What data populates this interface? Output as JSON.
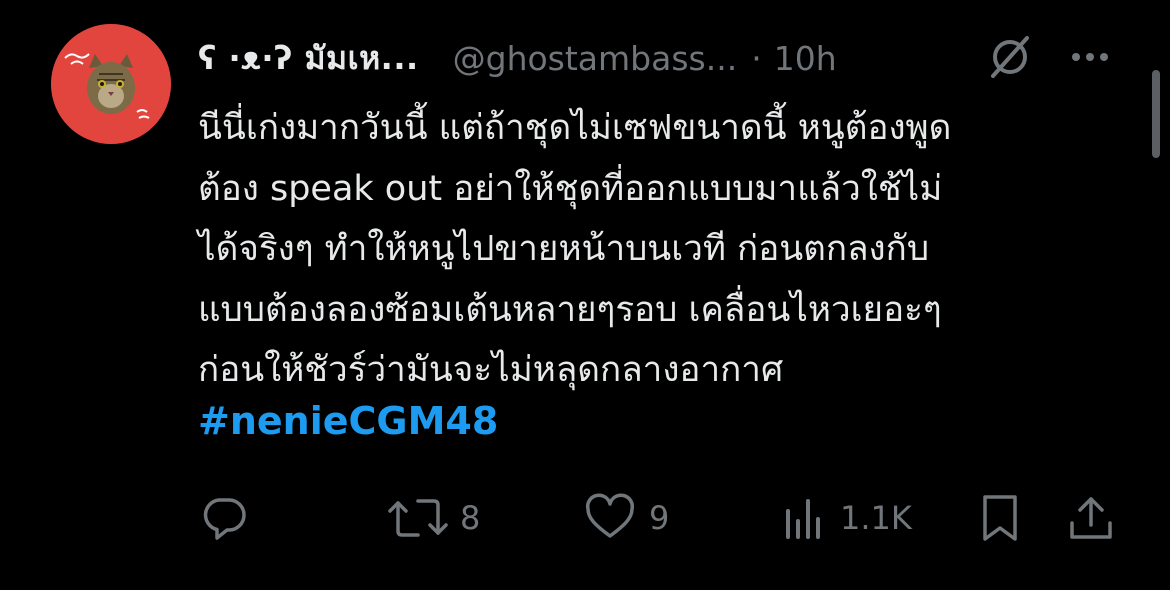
{
  "tweet": {
    "display_name": "ʕ ·ᴥ·ʔ มัมเห...",
    "handle": "@ghostambass...",
    "separator": "·",
    "time": "10h",
    "body_lines": [
      "นีนี่เก่งมากวันนี้ แต่ถ้าชุดไม่เซฟขนาดนี้ หนูต้องพูด",
      "ต้อง speak out อย่าให้ชุดที่ออกแบบมาแล้วใช้ไม่",
      "ได้จริงๆ ทำให้หนูไปขายหน้าบนเวที ก่อนตกลงกับ",
      "แบบต้องลองซ้อมเต้นหลายๆรอบ เคลื่อนไหวเยอะๆ",
      "ก่อนให้ชัวร์ว่ามันจะไม่หลุดกลางอากาศ"
    ],
    "hashtag": "#nenieCGM48"
  },
  "actions": {
    "reply_count": "",
    "retweet_count": "8",
    "like_count": "9",
    "views_count": "1.1K"
  },
  "icons": {
    "avatar": "cat-avatar-icon",
    "grok": "grok-icon",
    "more": "more-icon",
    "reply": "reply-icon",
    "retweet": "retweet-icon",
    "like": "heart-icon",
    "views": "views-icon",
    "bookmark": "bookmark-icon",
    "share": "share-icon"
  },
  "colors": {
    "background": "#000000",
    "text": "#e7e9ea",
    "muted": "#71767b",
    "link": "#1d9bf0",
    "avatar_bg": "#e2453d"
  }
}
